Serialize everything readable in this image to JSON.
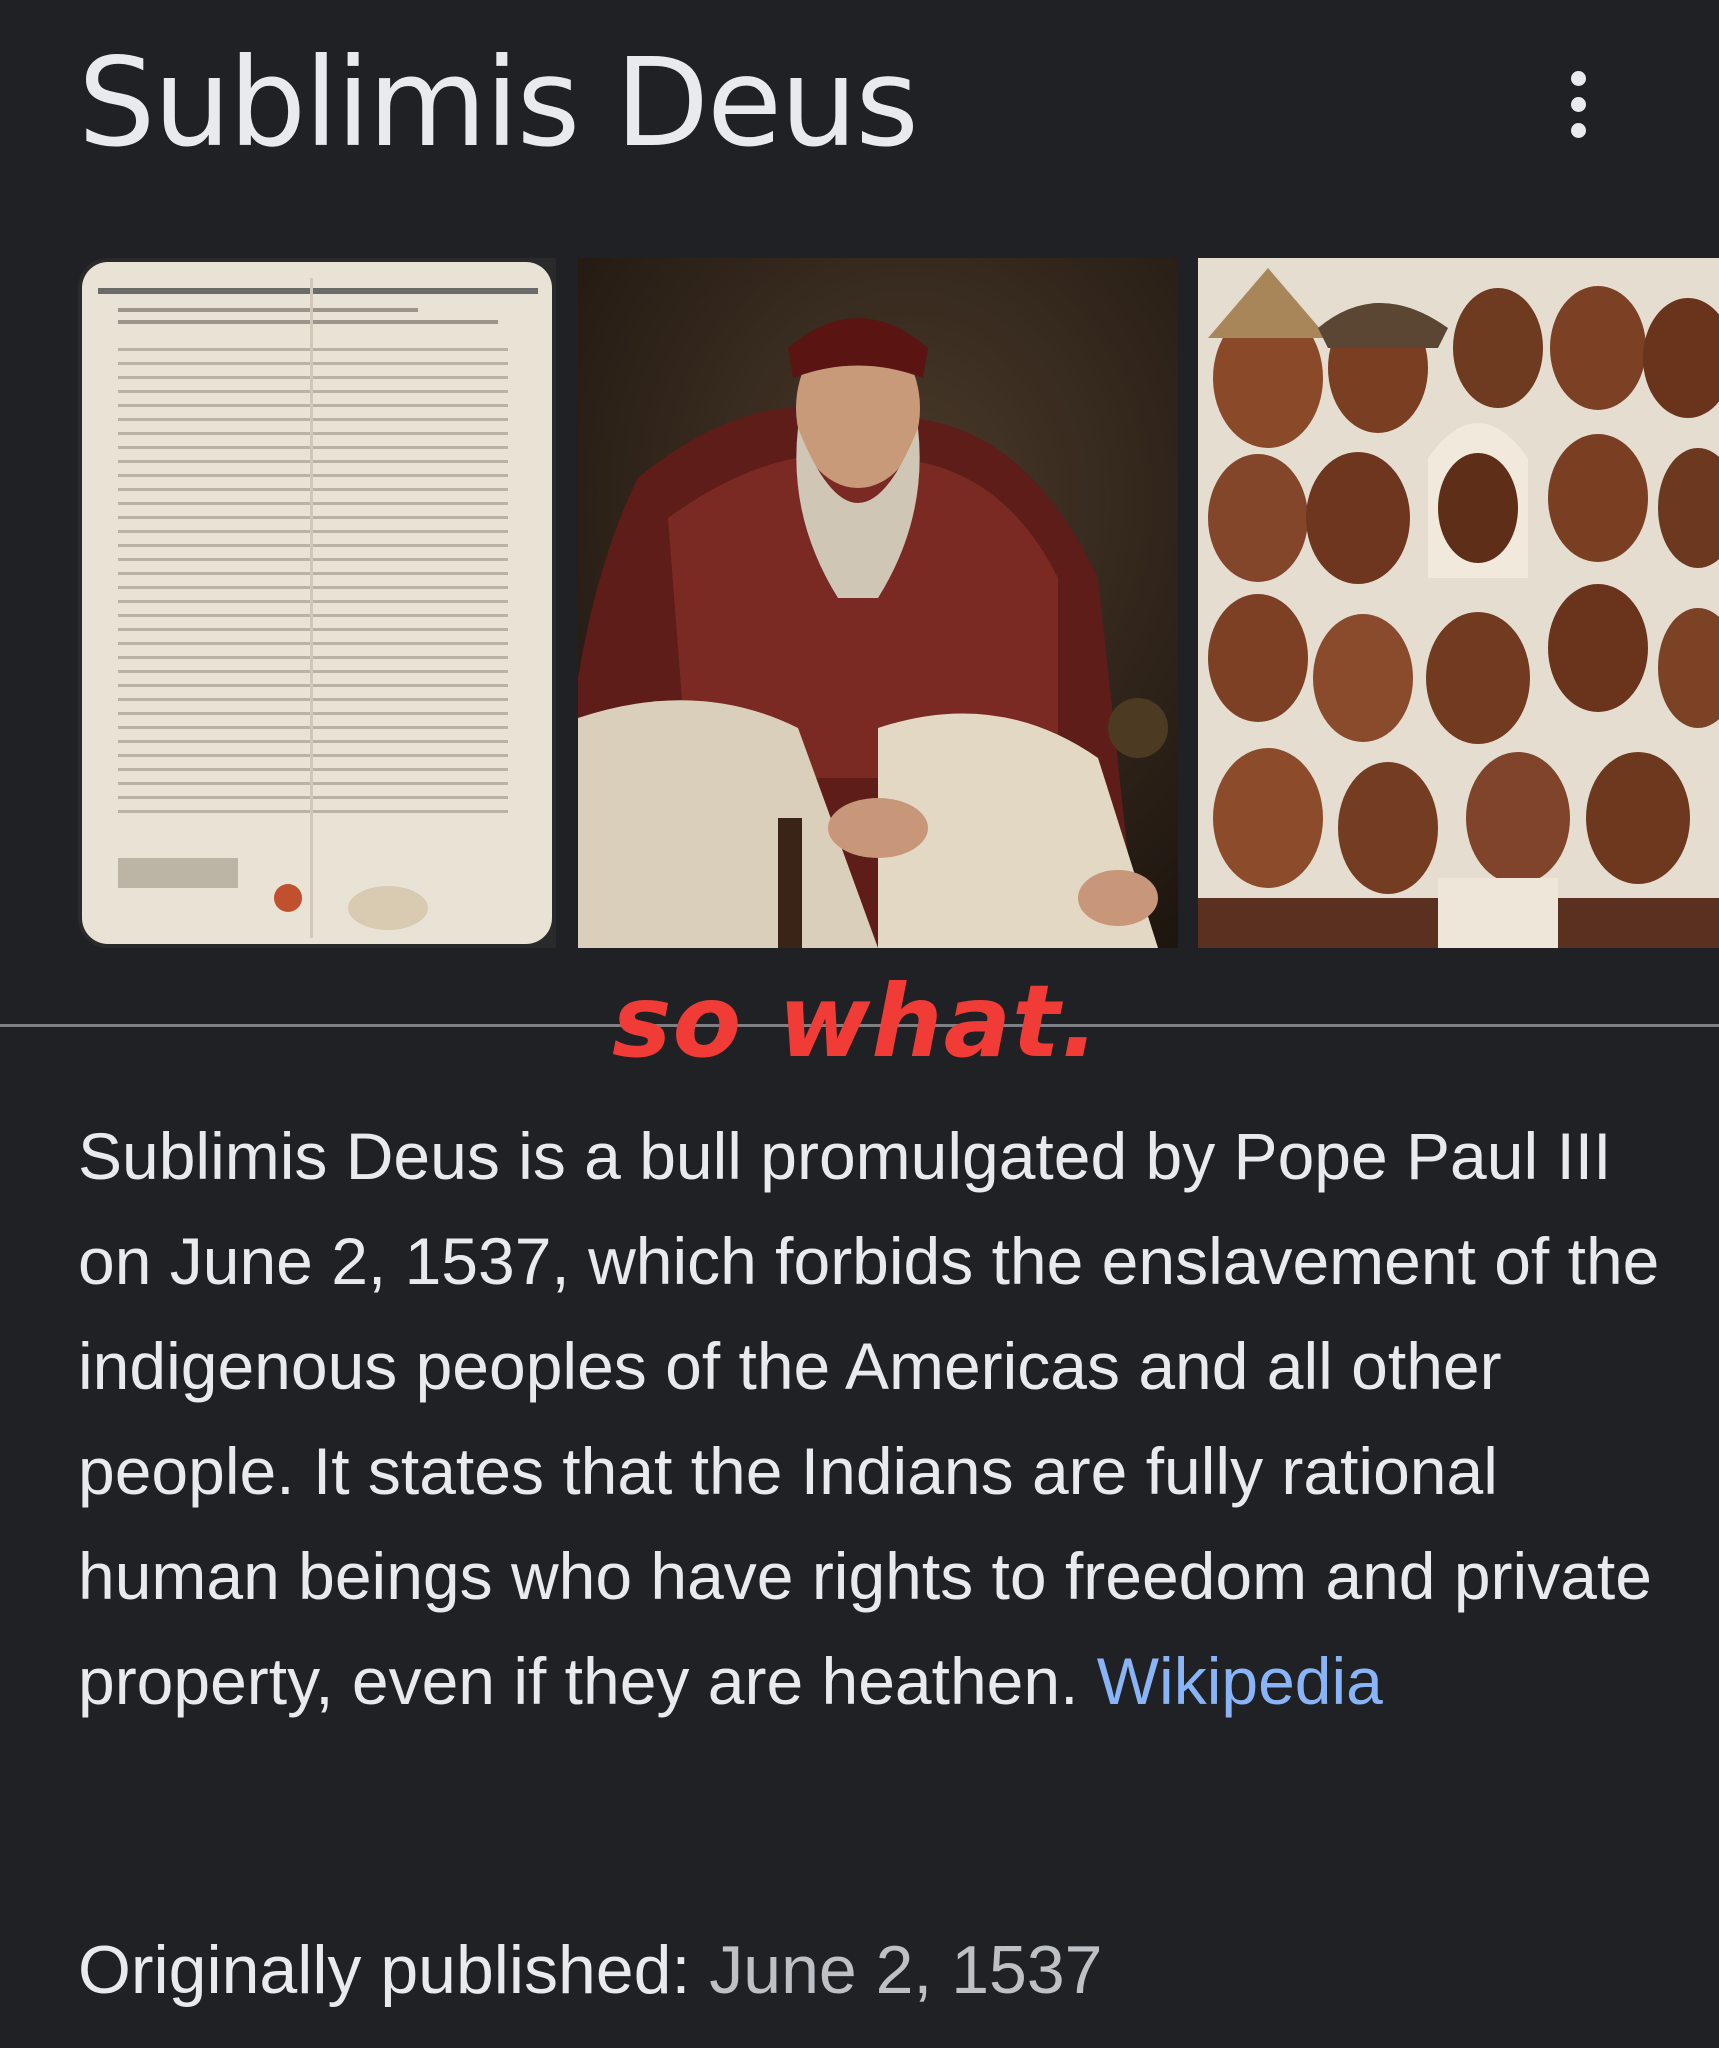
{
  "panel": {
    "title": "Sublimis Deus",
    "more_icon": "more-vert-icon"
  },
  "images": [
    {
      "name": "document-image",
      "depicts": "papal bull document"
    },
    {
      "name": "portrait-image",
      "depicts": "portrait of Pope Paul III"
    },
    {
      "name": "people-image",
      "depicts": "illustration of indigenous peoples"
    }
  ],
  "overlay": {
    "caption": "so what.",
    "color": "#f03b37"
  },
  "description": {
    "text": "Sublimis Deus is a bull promulgated by Pope Paul III on June 2, 1537, which forbids the enslavement of the indigenous peoples of the Americas and all other people. It states that the Indians are fully rational human beings who have rights to freedom and private property, even if they are heathen.",
    "source_label": "Wikipedia",
    "source_color": "#8ab4f8"
  },
  "facts": {
    "published_label": "Originally published:",
    "published_value": "June 2, 1537"
  },
  "colors": {
    "background": "#202124",
    "text": "#e8eaed"
  }
}
